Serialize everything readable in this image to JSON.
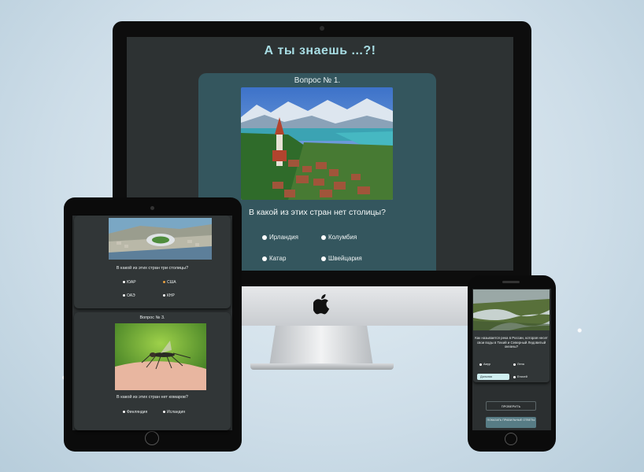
{
  "desktop": {
    "site_title": "А ты знаешь ...?!",
    "question_number": "Вопрос № 1.",
    "question_text": "В какой из этих стран нет столицы?",
    "options": [
      "Ирландия",
      "Колумбия",
      "Катар",
      "Швейцария"
    ]
  },
  "tablet": {
    "q2_text": "В какой из этих стран три столицы?",
    "q2_options": [
      "ЮАР",
      "США",
      "ОАЭ",
      "КНР"
    ],
    "q3_number": "Вопрос № 3.",
    "q3_text": "В какой из этих стран нет комаров?",
    "q3_options": [
      "Финляндия",
      "Исландия"
    ]
  },
  "phone": {
    "question_text": "Как называется река в России, которая несет свои воды в Тихий и Северный Ледовитый океаны?",
    "options": [
      "Амур",
      "Лена",
      "Дальняя",
      "Енисей"
    ],
    "check_button": "ПРОВЕРИТЬ",
    "show_answers_button": "ПОКАЗАТЬ ПРАВИЛЬНЫЕ ОТВЕТЫ"
  },
  "colors": {
    "title": "#a8dde4",
    "card": "#34565e",
    "screen_bg": "#2d3233",
    "highlight": "#cfeef0"
  },
  "icons": [
    "apple-logo-icon",
    "radio-icon"
  ]
}
